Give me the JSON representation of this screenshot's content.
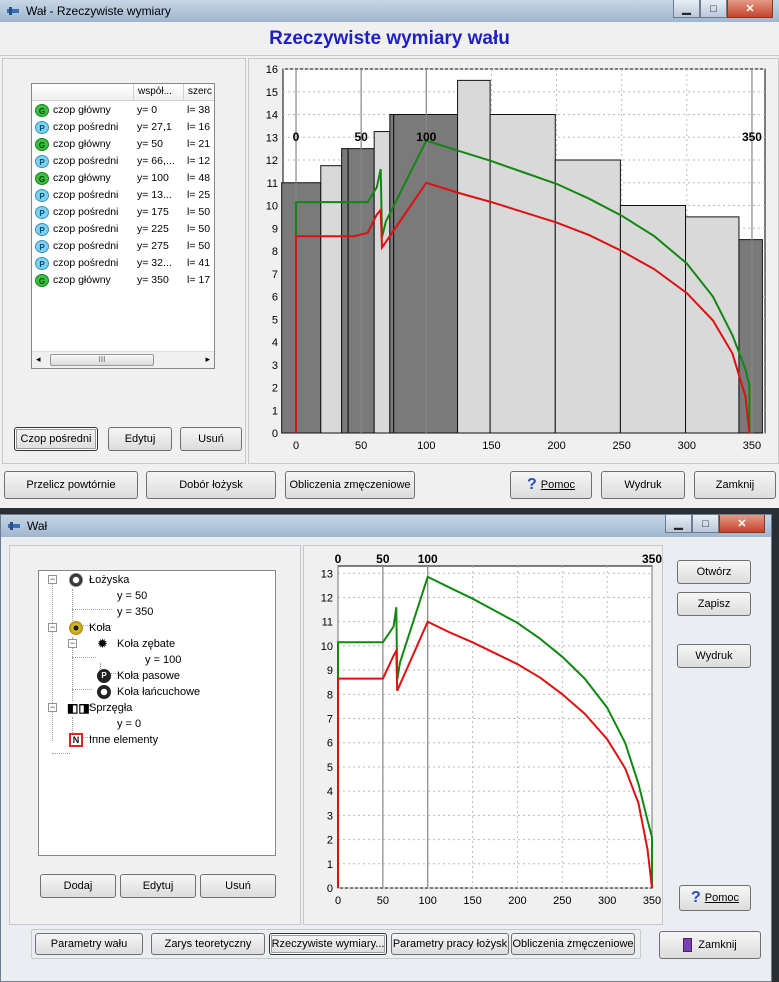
{
  "top": {
    "title": "Wał - Rzeczywiste wymiary",
    "heading": "Rzeczywiste wymiary wału",
    "list": {
      "headers": [
        "",
        "współ...",
        "szerc"
      ],
      "rows": [
        {
          "type": "G",
          "name": "czop główny",
          "pos": "y= 0",
          "w": "l= 38"
        },
        {
          "type": "P",
          "name": "czop pośredni",
          "pos": "y= 27,1",
          "w": "l= 16"
        },
        {
          "type": "G",
          "name": "czop główny",
          "pos": "y= 50",
          "w": "l= 21"
        },
        {
          "type": "P",
          "name": "czop pośredni",
          "pos": "y= 66,...",
          "w": "l= 12"
        },
        {
          "type": "G",
          "name": "czop główny",
          "pos": "y= 100",
          "w": "l= 48"
        },
        {
          "type": "P",
          "name": "czop pośredni",
          "pos": "y= 13...",
          "w": "l= 25"
        },
        {
          "type": "P",
          "name": "czop pośredni",
          "pos": "y= 175",
          "w": "l= 50"
        },
        {
          "type": "P",
          "name": "czop pośredni",
          "pos": "y= 225",
          "w": "l= 50"
        },
        {
          "type": "P",
          "name": "czop pośredni",
          "pos": "y= 275",
          "w": "l= 50"
        },
        {
          "type": "P",
          "name": "czop pośredni",
          "pos": "y= 32...",
          "w": "l= 41"
        },
        {
          "type": "G",
          "name": "czop główny",
          "pos": "y= 350",
          "w": "l= 17"
        }
      ],
      "scroll_thumb": "III"
    },
    "buttons": {
      "czop": "Czop pośredni",
      "edytuj": "Edytuj",
      "usun": "Usuń"
    },
    "bottom": {
      "przelicz": "Przelicz powtórnie",
      "dobor": "Dobór łożysk",
      "obliczenia": "Obliczenia zmęczeniowe",
      "pomoc": "Pomoc",
      "wydruk": "Wydruk",
      "zamknij": "Zamknij"
    }
  },
  "bottom": {
    "title": "Wał",
    "tree": {
      "lozyska": "Łożyska",
      "l_y1": "y = 50",
      "l_y2": "y = 350",
      "kola": "Koła",
      "zebate": "Koła zębate",
      "z_y": "y = 100",
      "pasowe": "Koła pasowe",
      "lancuchowe": "Koła łańcuchowe",
      "sprzegla": "Sprzęgła",
      "s_y": "y = 0",
      "inne": "Inne elementy"
    },
    "buttons": {
      "dodaj": "Dodaj",
      "edytuj": "Edytuj",
      "usun": "Usuń",
      "otworz": "Otwórz",
      "zapisz": "Zapisz",
      "wydruk": "Wydruk",
      "pomoc": "Pomoc",
      "zamknij": "Zamknij"
    },
    "tabs": [
      "Parametry wału",
      "Zarys teoretyczny",
      "Rzeczywiste wymiary...",
      "Parametry pracy łożysk",
      "Obliczenia zmęczeniowe"
    ]
  },
  "chart_data": [
    {
      "type": "line",
      "xlim": [
        -10,
        360
      ],
      "ylim": [
        0,
        16
      ],
      "xticks": [
        0,
        50,
        100,
        150,
        200,
        250,
        300,
        350
      ],
      "yticks": [
        0,
        1,
        2,
        3,
        4,
        5,
        6,
        7,
        8,
        9,
        10,
        11,
        12,
        13,
        14,
        15,
        16
      ],
      "markers": [
        0,
        50,
        100,
        350
      ],
      "bars": [
        {
          "x0": -11,
          "x1": 19,
          "h": 11,
          "shade": "dark"
        },
        {
          "x0": 19,
          "x1": 35,
          "h": 11.75,
          "shade": "light"
        },
        {
          "x0": 35,
          "x1": 40,
          "h": 12.5,
          "shade": "dark"
        },
        {
          "x0": 40,
          "x1": 60,
          "h": 12.5,
          "shade": "dark"
        },
        {
          "x0": 60,
          "x1": 72,
          "h": 13.25,
          "shade": "light"
        },
        {
          "x0": 72,
          "x1": 75,
          "h": 14,
          "shade": "dark"
        },
        {
          "x0": 75,
          "x1": 124,
          "h": 14,
          "shade": "dark"
        },
        {
          "x0": 124,
          "x1": 149,
          "h": 15.5,
          "shade": "light"
        },
        {
          "x0": 149,
          "x1": 199,
          "h": 14,
          "shade": "light"
        },
        {
          "x0": 199,
          "x1": 249,
          "h": 12,
          "shade": "light"
        },
        {
          "x0": 249,
          "x1": 299,
          "h": 10,
          "shade": "light"
        },
        {
          "x0": 299,
          "x1": 340,
          "h": 9.5,
          "shade": "light"
        },
        {
          "x0": 340,
          "x1": 358,
          "h": 8.5,
          "shade": "dark"
        }
      ],
      "series": [
        {
          "color": "#118811",
          "points": [
            [
              0,
              0
            ],
            [
              0,
              10.15
            ],
            [
              55,
              10.15
            ],
            [
              62,
              10.8
            ],
            [
              65,
              11.6
            ],
            [
              66,
              8.6
            ],
            [
              69,
              9.3
            ],
            [
              100,
              12.85
            ],
            [
              125,
              12.4
            ],
            [
              150,
              11.95
            ],
            [
              175,
              11.45
            ],
            [
              200,
              10.95
            ],
            [
              225,
              10.3
            ],
            [
              250,
              9.55
            ],
            [
              275,
              8.65
            ],
            [
              300,
              7.45
            ],
            [
              320,
              6.0
            ],
            [
              335,
              4.3
            ],
            [
              345,
              2.8
            ],
            [
              348,
              2.1
            ],
            [
              348,
              0
            ]
          ]
        },
        {
          "color": "#dd1111",
          "points": [
            [
              0,
              0
            ],
            [
              0,
              8.65
            ],
            [
              45,
              8.65
            ],
            [
              55,
              8.8
            ],
            [
              62,
              9.6
            ],
            [
              65,
              9.8
            ],
            [
              66,
              8.15
            ],
            [
              75,
              8.9
            ],
            [
              100,
              11.0
            ],
            [
              125,
              10.55
            ],
            [
              150,
              10.15
            ],
            [
              175,
              9.7
            ],
            [
              200,
              9.25
            ],
            [
              225,
              8.7
            ],
            [
              250,
              8.0
            ],
            [
              275,
              7.2
            ],
            [
              300,
              6.15
            ],
            [
              320,
              4.95
            ],
            [
              335,
              3.5
            ],
            [
              345,
              1.6
            ],
            [
              348,
              0
            ]
          ]
        }
      ]
    },
    {
      "type": "line",
      "xlim": [
        0,
        350
      ],
      "ylim": [
        0,
        13.3
      ],
      "xticks": [
        0,
        50,
        100,
        150,
        200,
        250,
        300,
        350
      ],
      "yticks": [
        0,
        1,
        2,
        3,
        4,
        5,
        6,
        7,
        8,
        9,
        10,
        11,
        12,
        13
      ],
      "markers": [
        0,
        50,
        100,
        350
      ],
      "series": [
        {
          "color": "#118811",
          "points": [
            [
              0,
              0
            ],
            [
              0,
              10.15
            ],
            [
              50,
              10.15
            ],
            [
              62,
              10.8
            ],
            [
              65,
              11.6
            ],
            [
              66,
              8.6
            ],
            [
              69,
              9.3
            ],
            [
              100,
              12.85
            ],
            [
              125,
              12.4
            ],
            [
              150,
              11.95
            ],
            [
              175,
              11.45
            ],
            [
              200,
              10.95
            ],
            [
              225,
              10.3
            ],
            [
              250,
              9.55
            ],
            [
              275,
              8.65
            ],
            [
              300,
              7.45
            ],
            [
              320,
              6.0
            ],
            [
              335,
              4.3
            ],
            [
              345,
              2.8
            ],
            [
              350,
              2.1
            ],
            [
              350,
              0
            ]
          ]
        },
        {
          "color": "#dd1111",
          "points": [
            [
              0,
              0
            ],
            [
              0,
              8.65
            ],
            [
              50,
              8.65
            ],
            [
              62,
              9.6
            ],
            [
              65,
              9.8
            ],
            [
              66,
              8.15
            ],
            [
              75,
              8.9
            ],
            [
              100,
              11.0
            ],
            [
              125,
              10.55
            ],
            [
              150,
              10.15
            ],
            [
              175,
              9.7
            ],
            [
              200,
              9.25
            ],
            [
              225,
              8.7
            ],
            [
              250,
              8.0
            ],
            [
              275,
              7.2
            ],
            [
              300,
              6.15
            ],
            [
              320,
              4.95
            ],
            [
              335,
              3.5
            ],
            [
              345,
              1.6
            ],
            [
              350,
              0
            ]
          ]
        }
      ]
    }
  ]
}
